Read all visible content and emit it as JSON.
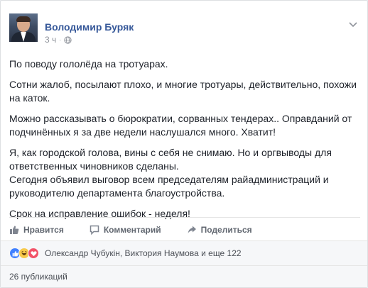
{
  "post": {
    "author": "Володимир Буряк",
    "time": "3 ч",
    "paragraphs": [
      "По поводу гололёда на тротуарах.",
      "Сотни жалоб, посылают плохо, и многие тротуары, действительно, похожи на каток.",
      "Можно рассказывать о бюрократии, сорванных тендерах.. Оправданий от подчинённых я за две недели наслушался много. Хватит!",
      "Я, как городской голова, вины с себя не снимаю. Но и оргвыводы для ответственных чиновников сделаны.",
      "Сегодня объявил выговор всем председателям райадминистраций и руководителю департамента благоустройства.",
      "Срок на исправление ошибок - неделя!"
    ]
  },
  "actions": {
    "like": "Нравится",
    "comment": "Комментарий",
    "share": "Поделиться"
  },
  "reactions": {
    "names": "Олександр Чубукін, Виктория Наумова и еще 122"
  },
  "shares": "26 публикаций",
  "colors": {
    "author_link": "#365899",
    "like_blue": "#4080ff",
    "haha_yellow": "#f7c94a",
    "love_red": "#f25268"
  }
}
